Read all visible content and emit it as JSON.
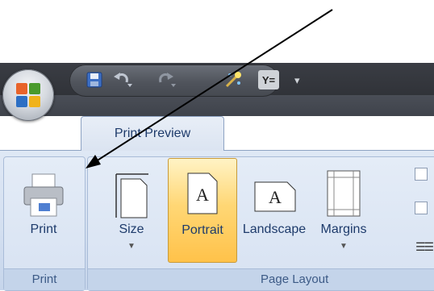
{
  "tabs": {
    "active": "Print Preview"
  },
  "quick_access": {
    "items": [
      "save-icon",
      "undo-icon",
      "redo-icon",
      "magic-wand-icon",
      "filter-icon"
    ],
    "filter_label": "Y="
  },
  "groups": {
    "print": {
      "label": "Print",
      "button": "Print"
    },
    "page_layout": {
      "label": "Page Layout",
      "buttons": {
        "size": "Size",
        "portrait": "Portrait",
        "landscape": "Landscape",
        "margins": "Margins"
      }
    }
  },
  "colors": {
    "selected_button": "#ffc24a",
    "ribbon": "#d3dff0",
    "title_bar": "#2f3238"
  }
}
